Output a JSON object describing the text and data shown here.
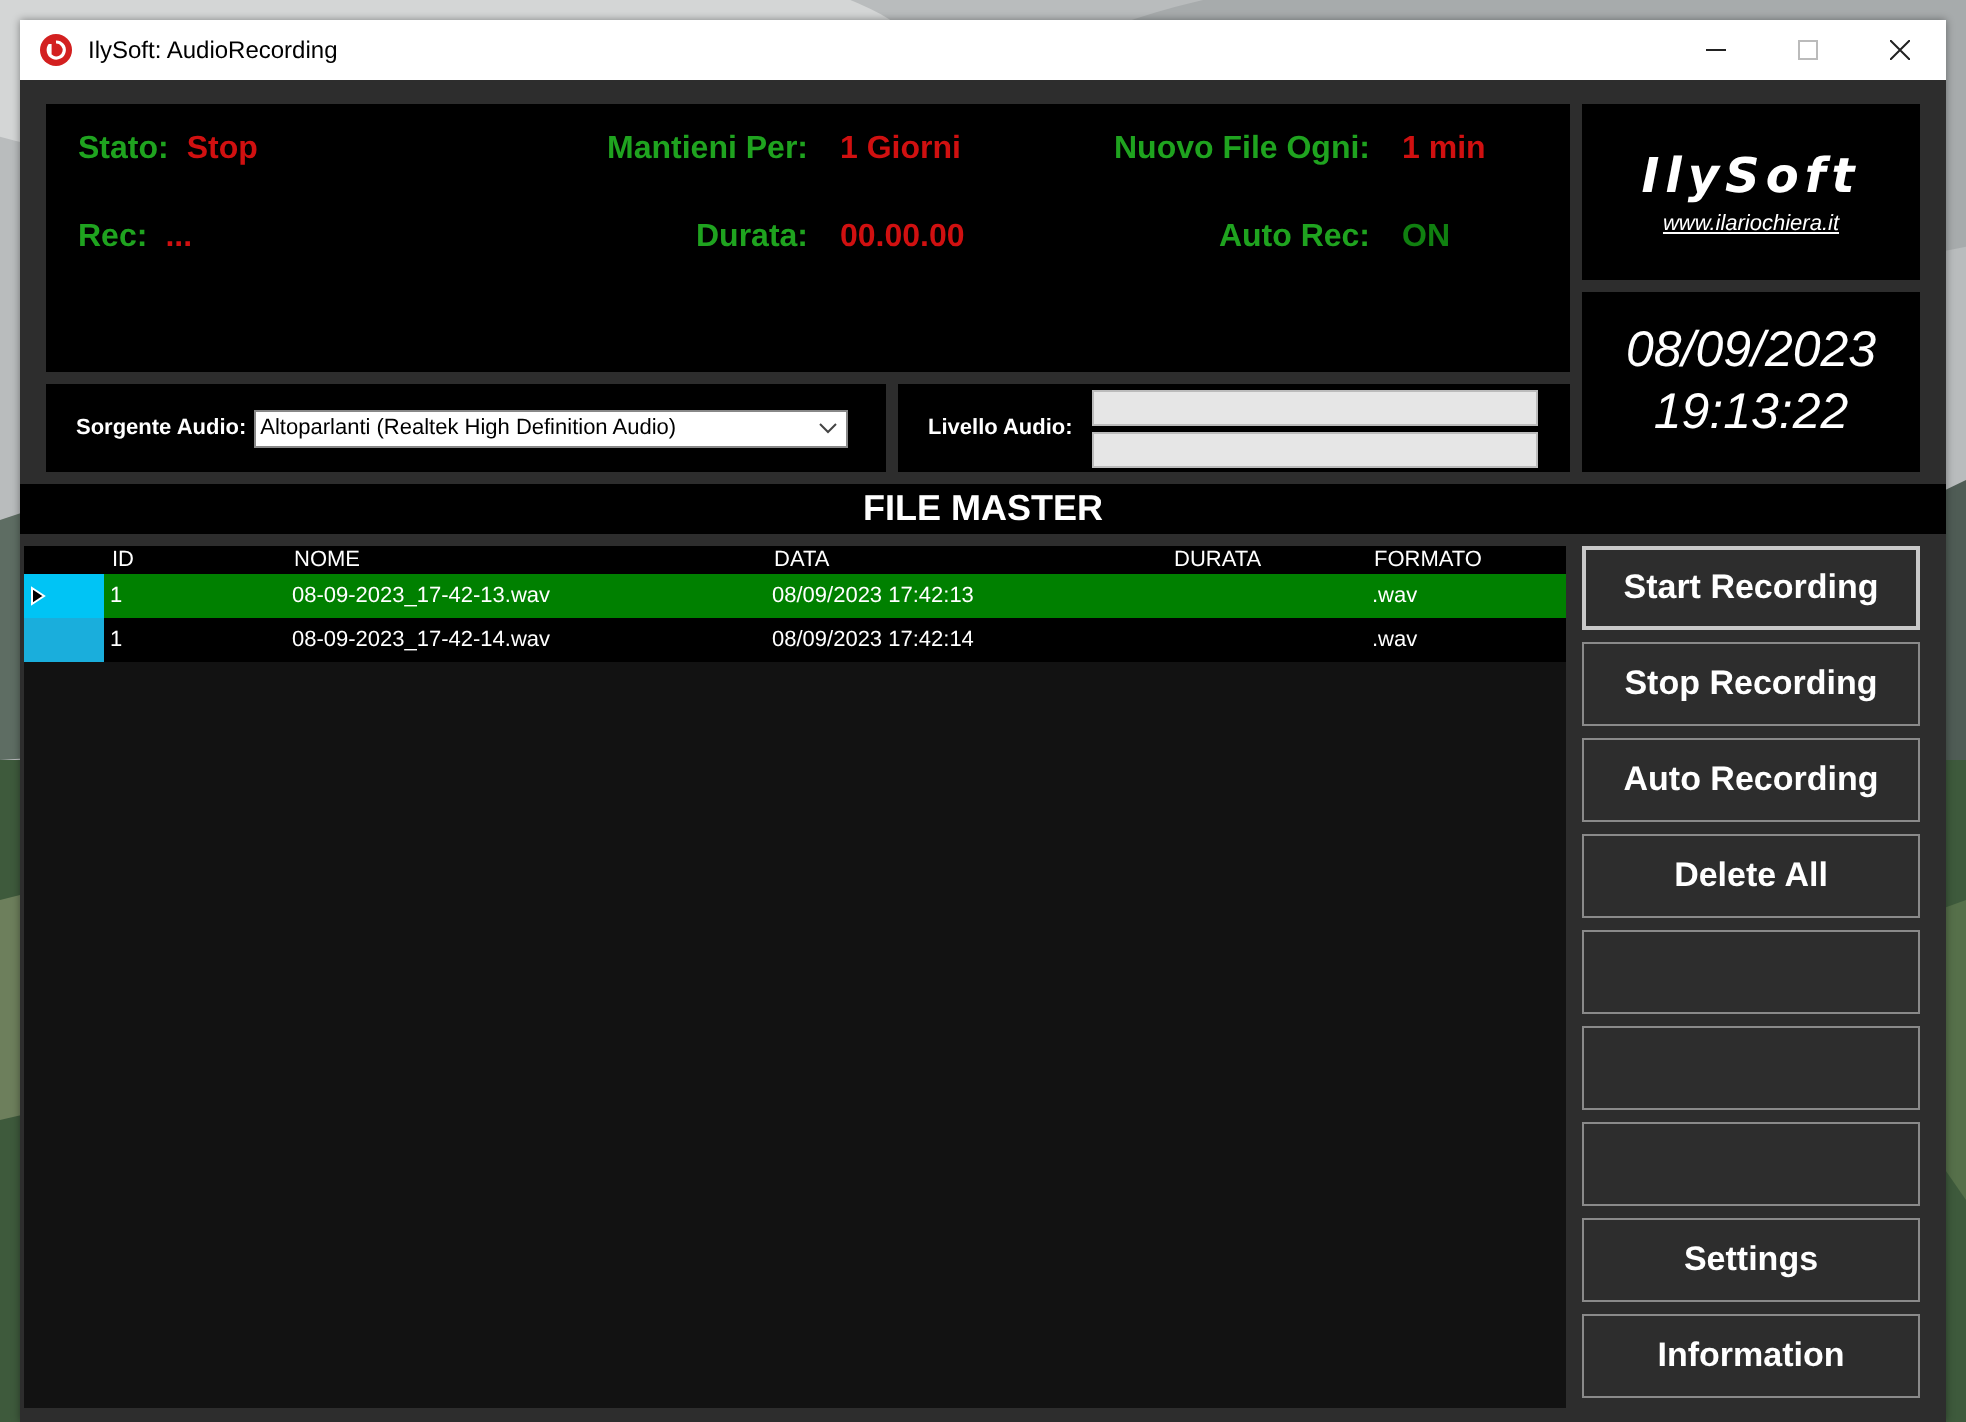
{
  "window": {
    "title": "IlySoft: AudioRecording"
  },
  "status": [
    {
      "label": "Stato:",
      "value": "Stop",
      "color": "#d01010"
    },
    {
      "label": "Mantieni Per:",
      "value": "1 Giorni",
      "color": "#d01010"
    },
    {
      "label": "Nuovo File Ogni:",
      "value": "1 min",
      "color": "#d01010"
    },
    {
      "label": "Rec:",
      "value": "...",
      "color": "#d01010"
    },
    {
      "label": "Durata:",
      "value": "00.00.00",
      "color": "#d01010"
    },
    {
      "label": "Auto Rec:",
      "value": "ON",
      "color": "#108010"
    }
  ],
  "source": {
    "label": "Sorgente Audio:",
    "value": "Altoparlanti (Realtek High Definition Audio)"
  },
  "level_meter": {
    "label": "Livello Audio:",
    "meters": [
      {
        "level": 0
      },
      {
        "level": 0
      }
    ]
  },
  "logo": {
    "name": "IlySoft",
    "link": "www.ilariochiera.it"
  },
  "clock": {
    "date": "08/09/2023",
    "time": "19:13:22"
  },
  "section_title": "FILE MASTER",
  "table": {
    "columns": [
      "ID",
      "NOME",
      "DATA",
      "DURATA",
      "FORMATO"
    ],
    "rows": [
      {
        "selected": true,
        "id": "1",
        "name": "08-09-2023_17-42-13.wav",
        "date": "08/09/2023 17:42:13",
        "format": ".wav"
      },
      {
        "selected": false,
        "id": "1",
        "name": "08-09-2023_17-42-14.wav",
        "date": "08/09/2023 17:42:14",
        "format": ".wav"
      }
    ]
  },
  "buttons": [
    {
      "kind": "text",
      "label": "Start Recording",
      "focused": true
    },
    {
      "kind": "text",
      "label": "Stop Recording",
      "focused": false
    },
    {
      "kind": "text",
      "label": "Auto Recording",
      "focused": false
    },
    {
      "kind": "text",
      "label": "Delete All",
      "focused": false
    },
    {
      "kind": "blank",
      "focused": false
    },
    {
      "kind": "blank",
      "focused": false
    },
    {
      "kind": "blank",
      "focused": false
    },
    {
      "kind": "text",
      "label": "Settings",
      "focused": false
    },
    {
      "kind": "text",
      "label": "Information",
      "focused": false
    }
  ]
}
